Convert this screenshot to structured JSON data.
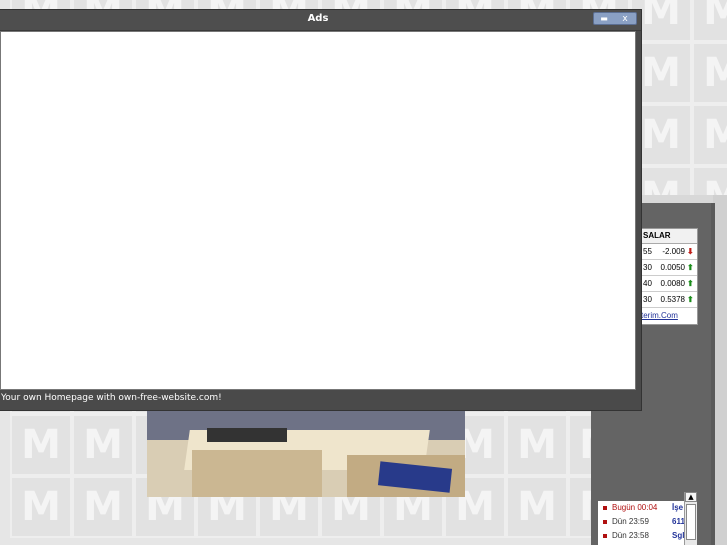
{
  "dialog": {
    "title": "Ads",
    "footer_text": "Your own Homepage with own-free-website.com!",
    "buttons": {
      "maximize": "▬",
      "close": "x"
    }
  },
  "forex": {
    "header": "SALAR",
    "rows": [
      {
        "prefix": "55",
        "value": "-2.009",
        "direction": "down"
      },
      {
        "prefix": "30",
        "value": "0.0050",
        "direction": "up"
      },
      {
        "prefix": "40",
        "value": "0.0080",
        "direction": "up"
      },
      {
        "prefix": "30",
        "value": "0.5378",
        "direction": "up"
      }
    ],
    "footer_link": "terim.Com",
    "arrow_up": "⬆",
    "arrow_down": "⬇",
    "colors": {
      "up": "#1a8c1a",
      "down": "#c0201a"
    }
  },
  "news": {
    "items": [
      {
        "time": "Bugün 00:04",
        "text": "İşe",
        "highlight": true
      },
      {
        "time": "Dün 23:59",
        "text": "611",
        "highlight": false
      },
      {
        "time": "Dün 23:58",
        "text": "Sgl",
        "highlight": false
      }
    ],
    "scroll_up": "▲"
  },
  "background": {
    "tile_letter": "M"
  }
}
